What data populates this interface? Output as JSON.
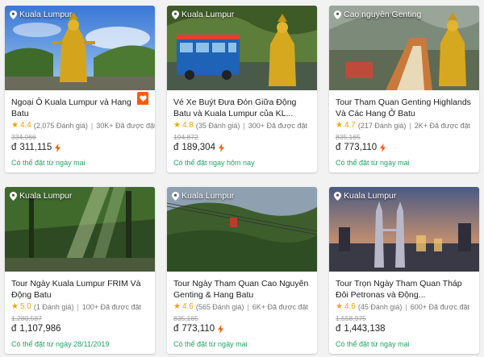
{
  "colors": {
    "accent": "#ff5b00",
    "star": "#f0a500",
    "available": "#21a366"
  },
  "cards": [
    {
      "location": "Kuala Lumpur",
      "title": "Ngoại Ô Kuala Lumpur và Hang Batu",
      "rating": "4.4",
      "reviews": "(2,075 Đánh giá)",
      "booked": "30K+ Đã được đặt",
      "old_price": "334,066",
      "currency": "đ",
      "price": "311,115",
      "availability": "Có thể đặt từ ngày mai",
      "wishlisted": true
    },
    {
      "location": "Kuala Lumpur",
      "title": "Vé Xe Buýt Đưa Đón Giữa Động Batu và Kuala Lumpur của KL...",
      "rating": "4.8",
      "reviews": "(35 Đánh giá)",
      "booked": "300+ Đã được đặt",
      "old_price": "194,872",
      "currency": "đ",
      "price": "189,304",
      "availability": "Có thể đặt ngay hôm nay"
    },
    {
      "location": "Cao nguyên Genting",
      "title": "Tour Tham Quan Genting Highlands Và Các Hang Ở Batu",
      "rating": "4.7",
      "reviews": "(217 Đánh giá)",
      "booked": "2K+ Đã được đặt",
      "old_price": "835,165",
      "currency": "đ",
      "price": "773,110",
      "availability": "Có thể đặt từ ngày mai"
    },
    {
      "location": "Kuala Lumpur",
      "title": "Tour Ngày Kuala Lumpur FRIM Và Động Batu",
      "rating": "5.0",
      "reviews": "(1 Đánh giá)",
      "booked": "100+ Đã được đặt",
      "old_price": "1,280,587",
      "currency": "đ",
      "price": "1,107,986",
      "availability": "Có thể đặt từ ngày 28/11/2019"
    },
    {
      "location": "Kuala Lumpur",
      "title": "Tour Ngày Tham Quan Cao Nguyên Genting & Hang Batu",
      "rating": "4.6",
      "reviews": "(565 Đánh giá)",
      "booked": "6K+ Đã được đặt",
      "old_price": "835,165",
      "currency": "đ",
      "price": "773,110",
      "availability": "Có thể đặt từ ngày mai"
    },
    {
      "location": "Kuala Lumpur",
      "title": "Tour Trọn Ngày Tham Quan Tháp Đôi Petronas và Động...",
      "rating": "4.6",
      "reviews": "(45 Đánh giá)",
      "booked": "600+ Đã được đặt",
      "old_price": "1,558,975",
      "currency": "đ",
      "price": "1,443,138",
      "availability": "Có thể đặt từ ngày mai"
    }
  ]
}
